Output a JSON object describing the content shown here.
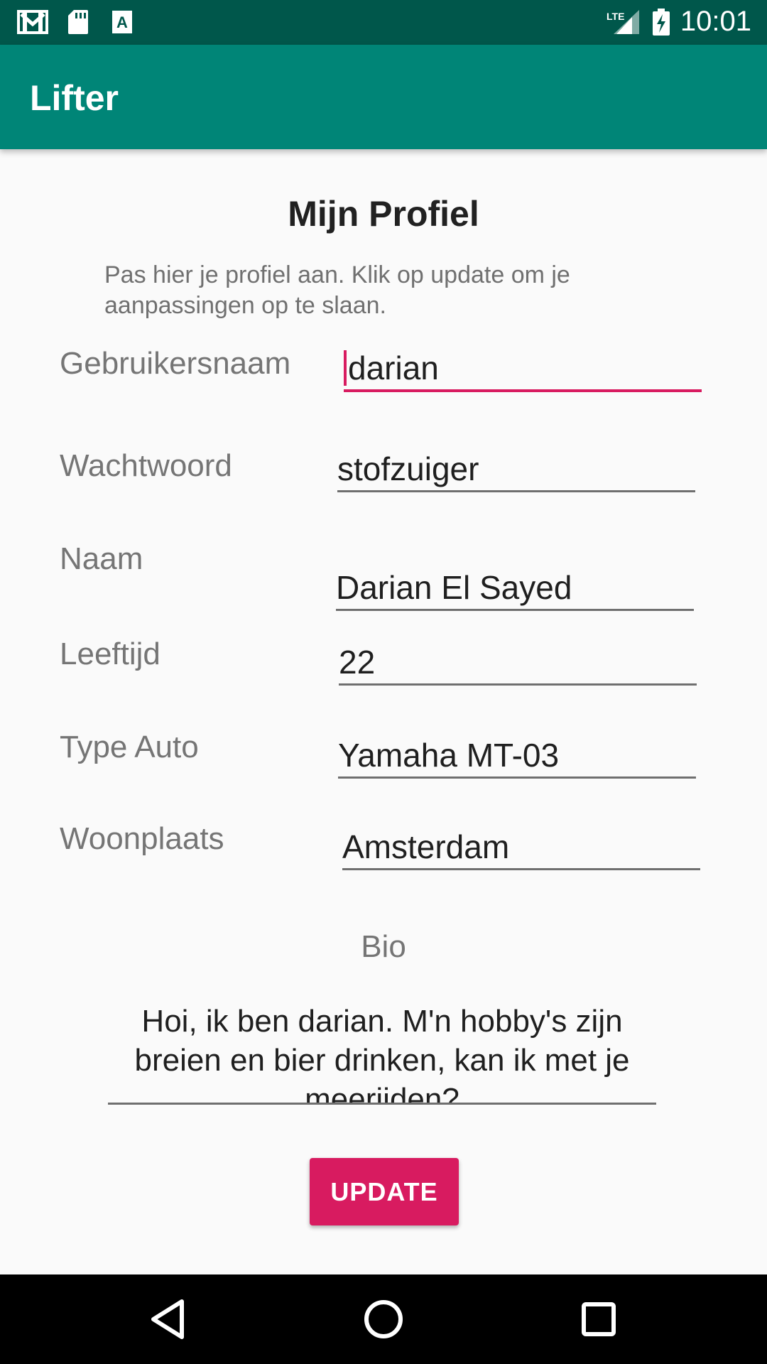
{
  "status_bar": {
    "time": "10:01",
    "network": "LTE",
    "icons": [
      "gmail-icon",
      "sd-card-icon",
      "a-icon",
      "lte-signal-icon",
      "battery-charging-icon"
    ]
  },
  "app_bar": {
    "title": "Lifter"
  },
  "profile": {
    "title": "Mijn Profiel",
    "description": "Pas hier je profiel aan. Klik op update om je aanpassingen op te slaan.",
    "fields": {
      "username": {
        "label": "Gebruikersnaam",
        "value": "darian"
      },
      "password": {
        "label": "Wachtwoord",
        "value": "stofzuiger"
      },
      "name": {
        "label": "Naam",
        "value": "Darian El Sayed"
      },
      "age": {
        "label": "Leeftijd",
        "value": "22"
      },
      "car_type": {
        "label": "Type Auto",
        "value": "Yamaha MT-03"
      },
      "city": {
        "label": "Woonplaats",
        "value": "Amsterdam"
      }
    },
    "bio": {
      "label": "Bio",
      "value": "Hoi, ik ben darian. M'n hobby's zijn breien en bier drinken, kan ik met je meerijden?"
    },
    "update_button": "UPDATE"
  },
  "colors": {
    "status_bar": "#00574b",
    "app_bar": "#008577",
    "accent": "#d81b60"
  }
}
